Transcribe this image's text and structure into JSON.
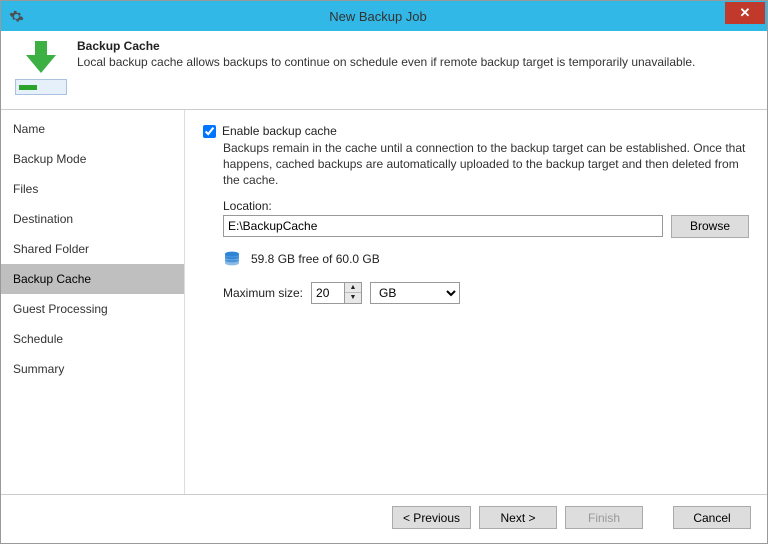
{
  "window": {
    "title": "New Backup Job"
  },
  "header": {
    "title": "Backup Cache",
    "desc": "Local backup cache allows backups to continue on schedule even if remote backup target is temporarily unavailable."
  },
  "sidebar": {
    "items": [
      {
        "label": "Name"
      },
      {
        "label": "Backup Mode"
      },
      {
        "label": "Files"
      },
      {
        "label": "Destination"
      },
      {
        "label": "Shared Folder"
      },
      {
        "label": "Backup Cache"
      },
      {
        "label": "Guest Processing"
      },
      {
        "label": "Schedule"
      },
      {
        "label": "Summary"
      }
    ],
    "selected_index": 5
  },
  "main": {
    "enable_label": "Enable backup cache",
    "enable_checked": true,
    "cache_desc": "Backups remain in the cache until a connection to the backup target can be established. Once that happens, cached backups are automatically uploaded to the backup target and then deleted from the cache.",
    "location_label": "Location:",
    "location_value": "E:\\BackupCache",
    "browse_label": "Browse",
    "disk_free_text": "59.8 GB free of 60.0 GB",
    "max_size_label": "Maximum size:",
    "max_size_value": "20",
    "max_size_unit": "GB"
  },
  "footer": {
    "previous": "< Previous",
    "next": "Next >",
    "finish": "Finish",
    "cancel": "Cancel"
  }
}
